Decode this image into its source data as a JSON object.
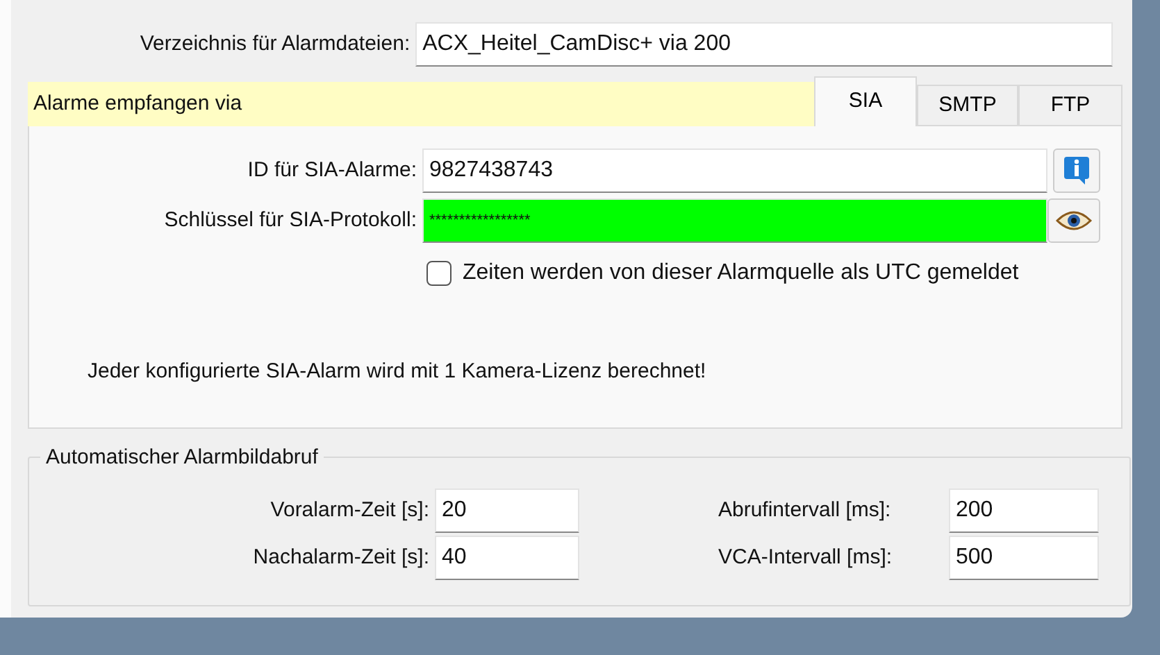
{
  "directory": {
    "label": "Verzeichnis für Alarmdateien:",
    "value": "ACX_Heitel_CamDisc+ via 200"
  },
  "receive_banner": "Alarme empfangen via",
  "tabs": [
    {
      "label": "SIA",
      "selected": true
    },
    {
      "label": "SMTP",
      "selected": false
    },
    {
      "label": "FTP",
      "selected": false
    }
  ],
  "sia": {
    "id": {
      "label": "ID für SIA-Alarme:",
      "value": "9827438743"
    },
    "key": {
      "label": "Schlüssel für SIA-Protokoll:",
      "value": "*****************",
      "valid": true
    },
    "utc": {
      "label": "Zeiten werden von dieser Alarmquelle als UTC gemeldet",
      "checked": false
    },
    "note": "Jeder konfigurierte SIA-Alarm wird mit 1 Kamera-Lizenz berechnet!"
  },
  "auto_fetch": {
    "title": "Automatischer Alarmbildabruf",
    "fields": [
      {
        "label": "Voralarm-Zeit [s]:",
        "value": "20"
      },
      {
        "label": "Abrufintervall [ms]:",
        "value": "200"
      },
      {
        "label": "Nachalarm-Zeit [s]:",
        "value": "40"
      },
      {
        "label": "VCA-Intervall [ms]:",
        "value": "500"
      }
    ]
  }
}
